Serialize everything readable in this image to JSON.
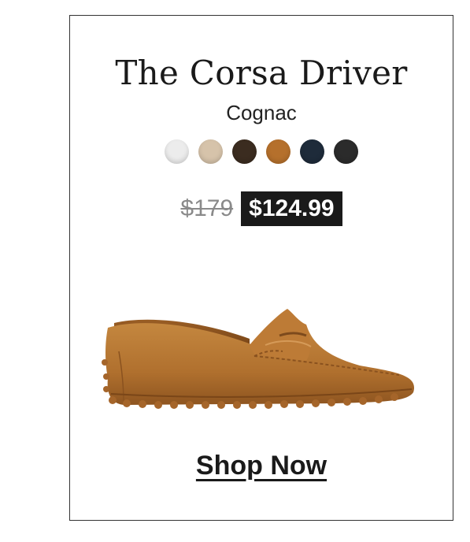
{
  "product": {
    "title": "The Corsa Driver",
    "color_name": "Cognac",
    "swatches": [
      {
        "name": "white",
        "color": "#ececec"
      },
      {
        "name": "bone",
        "color": "#d6c3aa"
      },
      {
        "name": "dark-brown",
        "color": "#3b2c20"
      },
      {
        "name": "cognac",
        "color": "#b5702c"
      },
      {
        "name": "navy",
        "color": "#1e2b3a"
      },
      {
        "name": "black",
        "color": "#2b2b2b"
      }
    ],
    "original_price": "$179",
    "sale_price": "$124.99",
    "image_icon": "suede-driving-loafer-cognac",
    "cta_label": "Shop Now"
  }
}
